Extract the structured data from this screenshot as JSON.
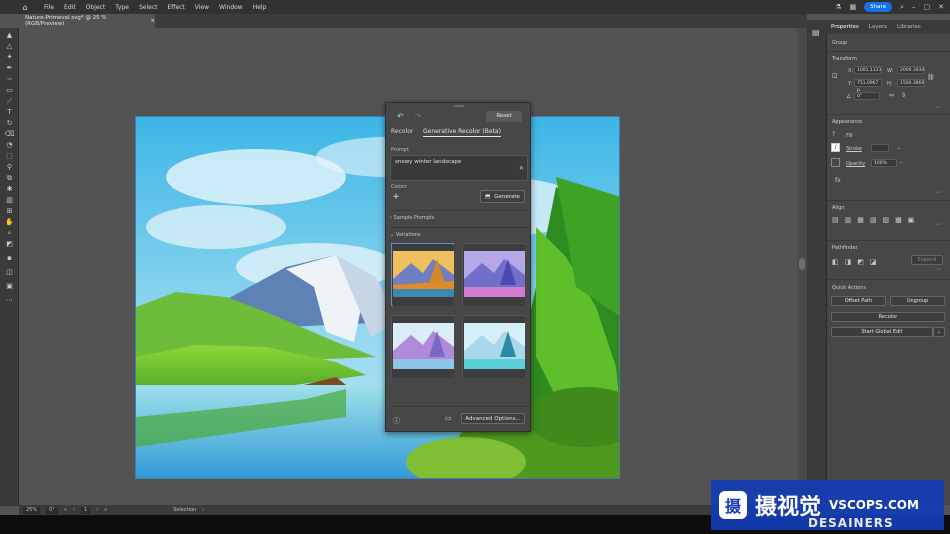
{
  "menu": {
    "items": [
      "File",
      "Edit",
      "Object",
      "Type",
      "Select",
      "Effect",
      "View",
      "Window",
      "Help"
    ],
    "share_label": "Share"
  },
  "document": {
    "tab_title": "Nature-Primeval.svg* @ 25 % (RGB/Preview)",
    "close_glyph": "×"
  },
  "recolor_panel": {
    "reset_label": "Reset",
    "tab_recolor": "Recolor",
    "tab_generative": "Generative Recolor (Beta)",
    "prompt_label": "Prompt",
    "prompt_value": "snowy winter landscape",
    "colors_label": "Colors",
    "generate_label": "Generate",
    "sample_prompts_label": "Sample Prompts",
    "variations_label": "Variations",
    "advanced_label": "Advanced Options..."
  },
  "right_panel": {
    "tabs": [
      "Properties",
      "Layers",
      "Libraries"
    ],
    "group_label": "Group",
    "transform_label": "Transform",
    "x_label": "X:",
    "x_value": "1001.1123",
    "y_label": "Y:",
    "y_value": "751.0967 p",
    "w_label": "W:",
    "w_value": "2000.3934",
    "h_label": "H:",
    "h_value": "1500.3866",
    "angle_value": "0°",
    "appearance_label": "Appearance",
    "fill_label": "Fill",
    "stroke_label": "Stroke",
    "opacity_label": "Opacity",
    "opacity_value": "100%",
    "fx_label": "fx",
    "align_label": "Align",
    "pathfinder_label": "Pathfinder",
    "expand_label": "Expand",
    "quick_actions_label": "Quick Actions",
    "offset_path_label": "Offset Path",
    "ungroup_label": "Ungroup",
    "recolor_label": "Recolor",
    "start_global_edit_label": "Start Global Edit"
  },
  "status": {
    "zoom": "25%",
    "rotation": "0°",
    "artboard": "1",
    "tool": "Selection"
  },
  "watermark": {
    "logo_char": "摄",
    "cn_text": "摄视觉",
    "url": "VSCOPS.COM",
    "sub": "DESAINERS"
  },
  "colors": {
    "accent": "#1473e6",
    "panel": "#474747",
    "canvas": "#535353"
  }
}
